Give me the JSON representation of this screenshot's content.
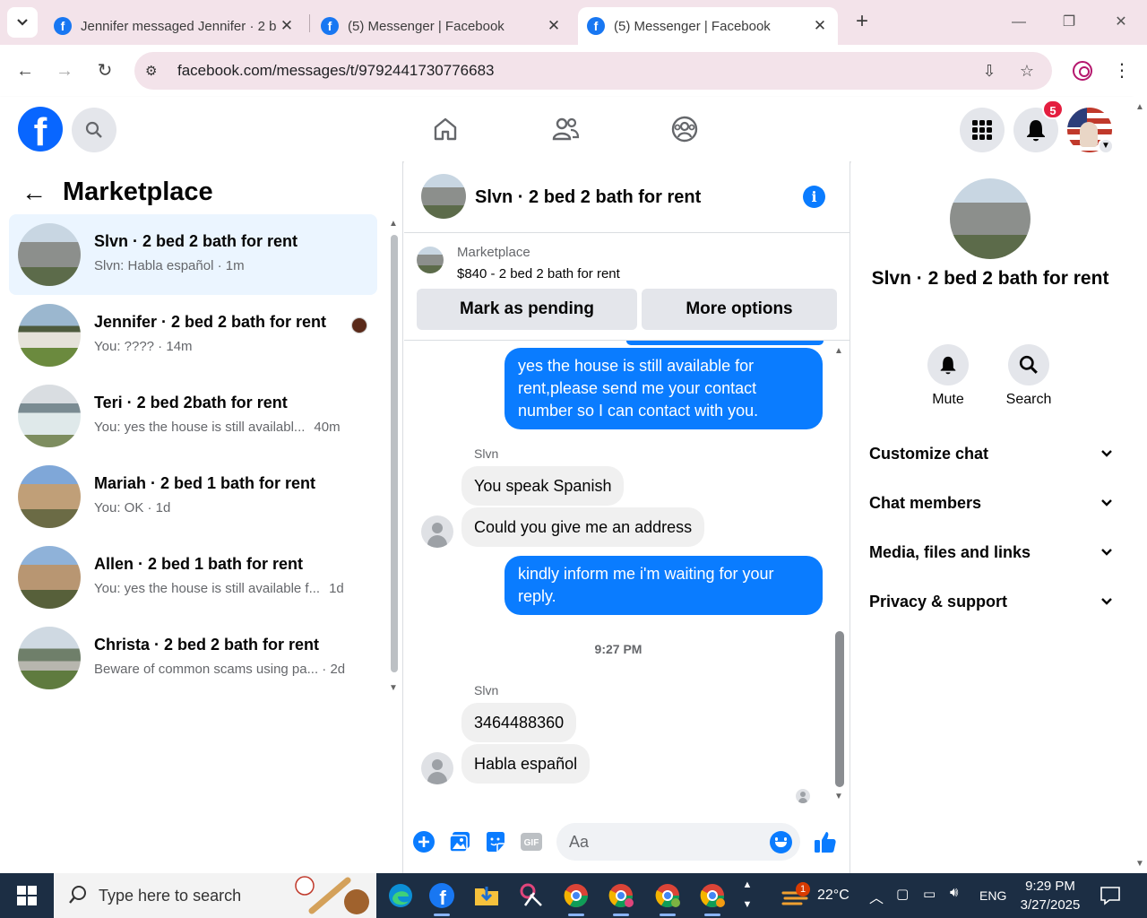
{
  "browser": {
    "tabs": [
      {
        "title": "Jennifer messaged Jennifer · 2 b",
        "active": false
      },
      {
        "title": "(5) Messenger | Facebook",
        "active": false
      },
      {
        "title": "(5) Messenger | Facebook",
        "active": true
      }
    ],
    "url": "facebook.com/messages/t/9792441730776683"
  },
  "header": {
    "notification_count": "5"
  },
  "sidebar": {
    "title": "Marketplace",
    "conversations": [
      {
        "title": "Slvn · 2 bed 2 bath for rent",
        "preview": "Slvn: Habla español · 1m",
        "time": ""
      },
      {
        "title": "Jennifer · 2 bed 2 bath for rent",
        "preview": "You: ???? · 14m",
        "time": ""
      },
      {
        "title": "Teri · 2 bed 2bath for rent",
        "preview": "You: yes the house is still availabl...",
        "time": "40m"
      },
      {
        "title": "Mariah · 2 bed 1 bath for rent",
        "preview": "You: OK · 1d",
        "time": ""
      },
      {
        "title": "Allen · 2 bed 1 bath for rent",
        "preview": "You: yes the house is still available f...",
        "time": "1d"
      },
      {
        "title": "Christa · 2 bed 2 bath for rent",
        "preview": "Beware of common scams using pa... · 2d",
        "time": ""
      }
    ]
  },
  "chat": {
    "name": "Slvn · 2 bed 2 bath for rent",
    "marketplace_label": "Marketplace",
    "listing": "$840 - 2 bed 2 bath for rent",
    "mark_pending_label": "Mark as pending",
    "more_options_label": "More options",
    "messages": {
      "m1": "yes the house is still available for rent,please send me your contact number so I can contact with you.",
      "sender1": "Slvn",
      "m2": "You speak Spanish",
      "m3": "Could you give me an address",
      "m4": "kindly inform me i'm waiting for your reply.",
      "timestamp": "9:27 PM",
      "sender2": "Slvn",
      "m5": "3464488360",
      "m6": "Habla español"
    },
    "composer_placeholder": "Aa"
  },
  "details": {
    "name": "Slvn · 2 bed 2 bath for rent",
    "actions": [
      "Mute",
      "Search"
    ],
    "sections": [
      "Customize chat",
      "Chat members",
      "Media, files and links",
      "Privacy & support"
    ]
  },
  "taskbar": {
    "search_placeholder": "Type here to search",
    "weather_badge": "1",
    "temperature": "22°C",
    "language": "ENG",
    "time": "9:29 PM",
    "date": "3/27/2025"
  },
  "colors": {
    "facebook_blue": "#0866ff",
    "messenger_blue": "#0a7cff",
    "selected_row": "#ebf5ff",
    "tab_strip": "#f3e3ea",
    "taskbar": "#1c2e44"
  }
}
